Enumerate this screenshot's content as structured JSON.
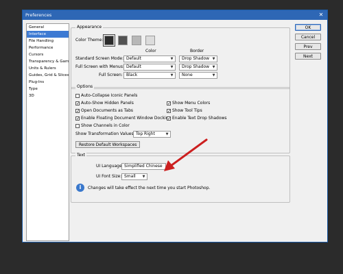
{
  "window": {
    "title": "Preferences",
    "close_glyph": "✕"
  },
  "categories": [
    "General",
    "Interface",
    "File Handling",
    "Performance",
    "Cursors",
    "Transparency & Gamut",
    "Units & Rulers",
    "Guides, Grid & Slices",
    "Plug-Ins",
    "Type",
    "3D"
  ],
  "selected_category": "Interface",
  "buttons": {
    "ok": "OK",
    "cancel": "Cancel",
    "prev": "Prev",
    "next": "Next"
  },
  "appearance": {
    "title": "Appearance",
    "color_theme_label": "Color Theme:",
    "col_color": "Color",
    "col_border": "Border",
    "rows": [
      {
        "label": "Standard Screen Mode:",
        "color": "Default",
        "border": "Drop Shadow"
      },
      {
        "label": "Full Screen with Menus:",
        "color": "Default",
        "border": "Drop Shadow"
      },
      {
        "label": "Full Screen:",
        "color": "Black",
        "border": "None"
      }
    ],
    "themes": [
      "#2b2b2b",
      "#535353",
      "#b8b8b8",
      "#dcdcdc"
    ]
  },
  "options": {
    "title": "Options",
    "left": [
      {
        "label": "Auto-Collapse Iconic Panels",
        "checked": false
      },
      {
        "label": "Auto-Show Hidden Panels",
        "checked": true
      },
      {
        "label": "Open Documents as Tabs",
        "checked": true
      },
      {
        "label": "Enable Floating Document Window Docking",
        "checked": true
      },
      {
        "label": "Show Channels in Color",
        "checked": false
      }
    ],
    "right": [
      {
        "label": "Show Menu Colors",
        "checked": true
      },
      {
        "label": "Show Tool Tips",
        "checked": true
      },
      {
        "label": "Enable Text Drop Shadows",
        "checked": true
      }
    ],
    "transform_label": "Show Transformation Values:",
    "transform_value": "Top Right",
    "restore_button": "Restore Default Workspaces"
  },
  "text": {
    "title": "Text",
    "ui_language_label": "UI Language:",
    "ui_language_value": "Simplified Chinese",
    "ui_font_label": "UI Font Size:",
    "ui_font_value": "Small",
    "info": "Changes will take effect the next time you start Photoshop."
  },
  "colors": {
    "titlebar": "#2e67b5",
    "selection": "#3d7ad3",
    "arrow": "#cc1f1f"
  },
  "icons": {
    "info": "info-icon",
    "arrow": "red-arrow-annotation",
    "dropdown": "chevron-down-icon"
  }
}
